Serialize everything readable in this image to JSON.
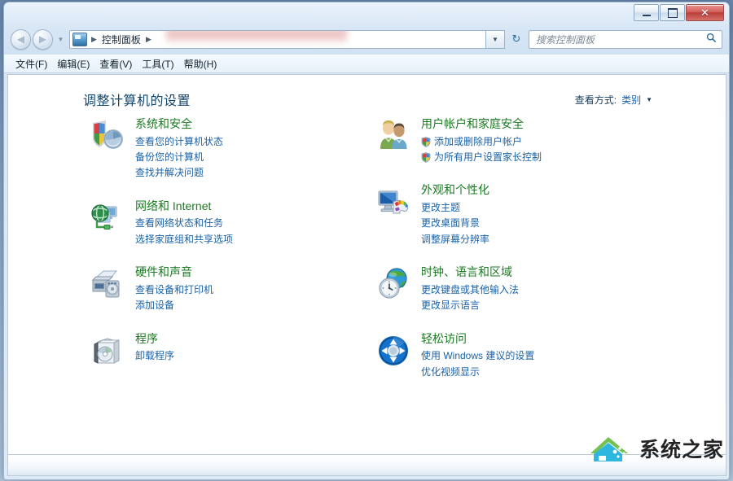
{
  "window": {
    "titlebar": {
      "minimize_label": "最小化",
      "maximize_label": "最大化",
      "close_label": "关闭"
    }
  },
  "nav": {
    "back_label": "后退",
    "forward_label": "前进",
    "recent_pages_label": "最近浏览的页面",
    "breadcrumb_root": "控制面板",
    "address_dropdown_label": "地址栏下拉",
    "refresh_label": "刷新",
    "refresh_icon": "↻"
  },
  "search": {
    "placeholder": "搜索控制面板",
    "icon": "search-icon"
  },
  "menu": {
    "items": [
      {
        "label": "文件(F)"
      },
      {
        "label": "编辑(E)"
      },
      {
        "label": "查看(V)"
      },
      {
        "label": "工具(T)"
      },
      {
        "label": "帮助(H)"
      }
    ]
  },
  "main": {
    "page_title": "调整计算机的设置",
    "view_by": {
      "label": "查看方式:",
      "value": "类别",
      "caret": "▼"
    },
    "left_column": [
      {
        "id": "system-and-security",
        "title": "系统和安全",
        "icon": "shield-icon",
        "links": [
          {
            "label": "查看您的计算机状态",
            "shield": false
          },
          {
            "label": "备份您的计算机",
            "shield": false
          },
          {
            "label": "查找并解决问题",
            "shield": false
          }
        ]
      },
      {
        "id": "network-and-internet",
        "title": "网络和 Internet",
        "icon": "network-globe-icon",
        "links": [
          {
            "label": "查看网络状态和任务",
            "shield": false
          },
          {
            "label": "选择家庭组和共享选项",
            "shield": false
          }
        ]
      },
      {
        "id": "hardware-and-sound",
        "title": "硬件和声音",
        "icon": "printer-icon",
        "links": [
          {
            "label": "查看设备和打印机",
            "shield": false
          },
          {
            "label": "添加设备",
            "shield": false
          }
        ]
      },
      {
        "id": "programs",
        "title": "程序",
        "icon": "software-box-icon",
        "links": [
          {
            "label": "卸载程序",
            "shield": false
          }
        ]
      }
    ],
    "right_column": [
      {
        "id": "user-accounts-and-family-safety",
        "title": "用户帐户和家庭安全",
        "icon": "users-icon",
        "links": [
          {
            "label": "添加或删除用户帐户",
            "shield": true
          },
          {
            "label": "为所有用户设置家长控制",
            "shield": true
          }
        ]
      },
      {
        "id": "appearance-and-personalization",
        "title": "外观和个性化",
        "icon": "monitor-palette-icon",
        "links": [
          {
            "label": "更改主题",
            "shield": false
          },
          {
            "label": "更改桌面背景",
            "shield": false
          },
          {
            "label": "调整屏幕分辨率",
            "shield": false
          }
        ]
      },
      {
        "id": "clock-language-and-region",
        "title": "时钟、语言和区域",
        "icon": "clock-globe-icon",
        "links": [
          {
            "label": "更改键盘或其他输入法",
            "shield": false
          },
          {
            "label": "更改显示语言",
            "shield": false
          }
        ]
      },
      {
        "id": "ease-of-access",
        "title": "轻松访问",
        "icon": "ease-of-access-icon",
        "links": [
          {
            "label": "使用 Windows 建议的设置",
            "shield": false
          },
          {
            "label": "优化视频显示",
            "shield": false
          }
        ]
      }
    ]
  },
  "watermark": {
    "text": "系统之家",
    "logo": "house-logo"
  },
  "colors": {
    "category_title": "#1a7a21",
    "link": "#1962a8",
    "page_title": "#14456b",
    "close_button": "#bb3e39",
    "frame": "#b9cada"
  }
}
